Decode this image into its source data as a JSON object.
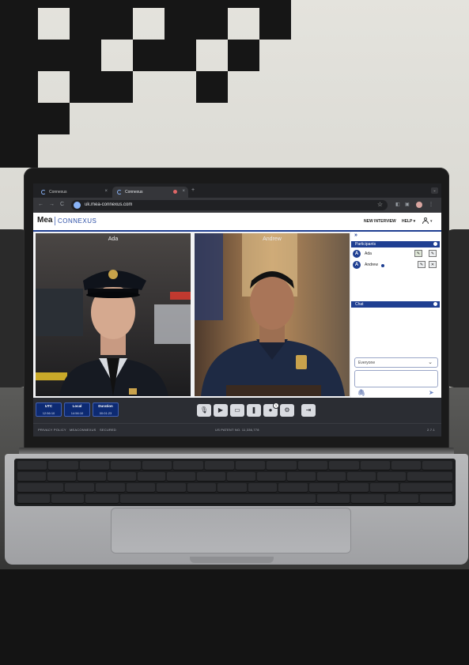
{
  "browser": {
    "tabs": [
      {
        "label": "Connexus",
        "close": "×"
      },
      {
        "label": "Connexus",
        "close": "×"
      }
    ],
    "new_tab": "+",
    "nav": {
      "back": "←",
      "forward": "→",
      "reload": "C"
    },
    "url": "uk.mea-connexus.com",
    "star": "☆"
  },
  "app": {
    "logo_mea": "Mea",
    "logo_connexus": "CONNEXUS",
    "nav": {
      "new_interview": "NEW INTERVIEW",
      "help": "HELP ▾"
    },
    "videos": [
      {
        "name": "Ada"
      },
      {
        "name": "Andrew"
      }
    ],
    "sidebar": {
      "expand": "»",
      "participants_title": "Participants",
      "participants": [
        {
          "initial": "A",
          "name": "Ada"
        },
        {
          "initial": "A",
          "name": "Andrew"
        }
      ],
      "chat_title": "Chat",
      "recipient": "Everyone",
      "recipient_caret": "⌄",
      "attach": "🖇",
      "send": "➤"
    },
    "toolbar": {
      "clocks": [
        {
          "label": "UTC",
          "value": "12:56:10"
        },
        {
          "label": "Local",
          "value": "14:56:10"
        },
        {
          "label": "Duration",
          "value": "00:01:23"
        }
      ],
      "badge_count": "1"
    },
    "footer": {
      "privacy": "PRIVACY POLICY",
      "company": "MEACONNEXUS",
      "secured": "SECURED",
      "patent": "US PATENT NO. 11,336,778",
      "version": "2.7.1"
    }
  }
}
